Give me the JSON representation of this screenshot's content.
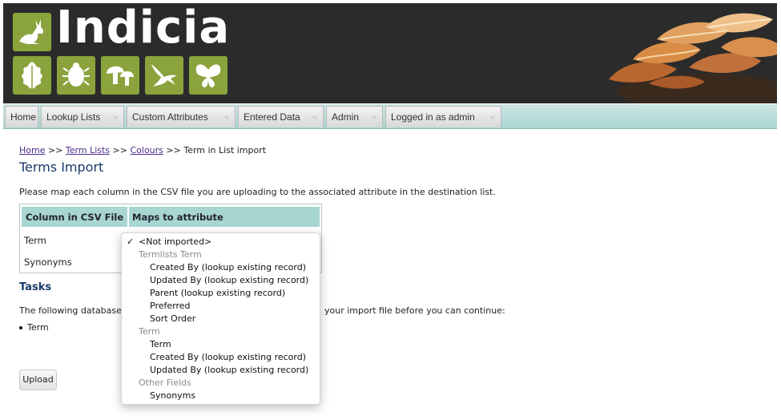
{
  "brand": {
    "name": "Indicia"
  },
  "nav": [
    {
      "label": "Home",
      "has_menu": false
    },
    {
      "label": "Lookup Lists",
      "has_menu": true
    },
    {
      "label": "Custom Attributes",
      "has_menu": true
    },
    {
      "label": "Entered Data",
      "has_menu": true
    },
    {
      "label": "Admin",
      "has_menu": true
    },
    {
      "label": "Logged in as admin",
      "has_menu": true
    }
  ],
  "breadcrumb": {
    "links": [
      "Home",
      "Term Lists",
      "Colours"
    ],
    "separator": ">>",
    "current": "Term in List import"
  },
  "page_title": "Terms Import",
  "intro": "Please map each column in the CSV file you are uploading to the associated attribute in the destination list.",
  "table": {
    "headers": [
      "Column in CSV File",
      "Maps to attribute"
    ],
    "rows": [
      "Term",
      "Synonyms"
    ]
  },
  "tasks": {
    "title": "Tasks",
    "text": "The following database attributes must be matched to a column in your import file before you can continue:",
    "text_visible_start": "The following database",
    "text_visible_end": "your import file before you can continue:",
    "items": [
      "Term"
    ]
  },
  "upload_label": "Upload",
  "dropdown": {
    "check": "✓",
    "selected": "<Not imported>",
    "groups": [
      {
        "label": "Termlists Term",
        "options": [
          "Created By (lookup existing record)",
          "Updated By (lookup existing record)",
          "Parent (lookup existing record)",
          "Preferred",
          "Sort Order"
        ]
      },
      {
        "label": "Term",
        "options": [
          "Term",
          "Created By (lookup existing record)",
          "Updated By (lookup existing record)"
        ]
      },
      {
        "label": "Other Fields",
        "options": [
          "Synonyms"
        ]
      }
    ]
  },
  "colors": {
    "banner_bg": "#2b2b2b",
    "logo_green": "#8aa33c",
    "nav_bg": "#a9d4d0",
    "table_header": "#a8d6d0",
    "title_blue": "#1a3b6b",
    "link_purple": "#4a2a8a"
  }
}
